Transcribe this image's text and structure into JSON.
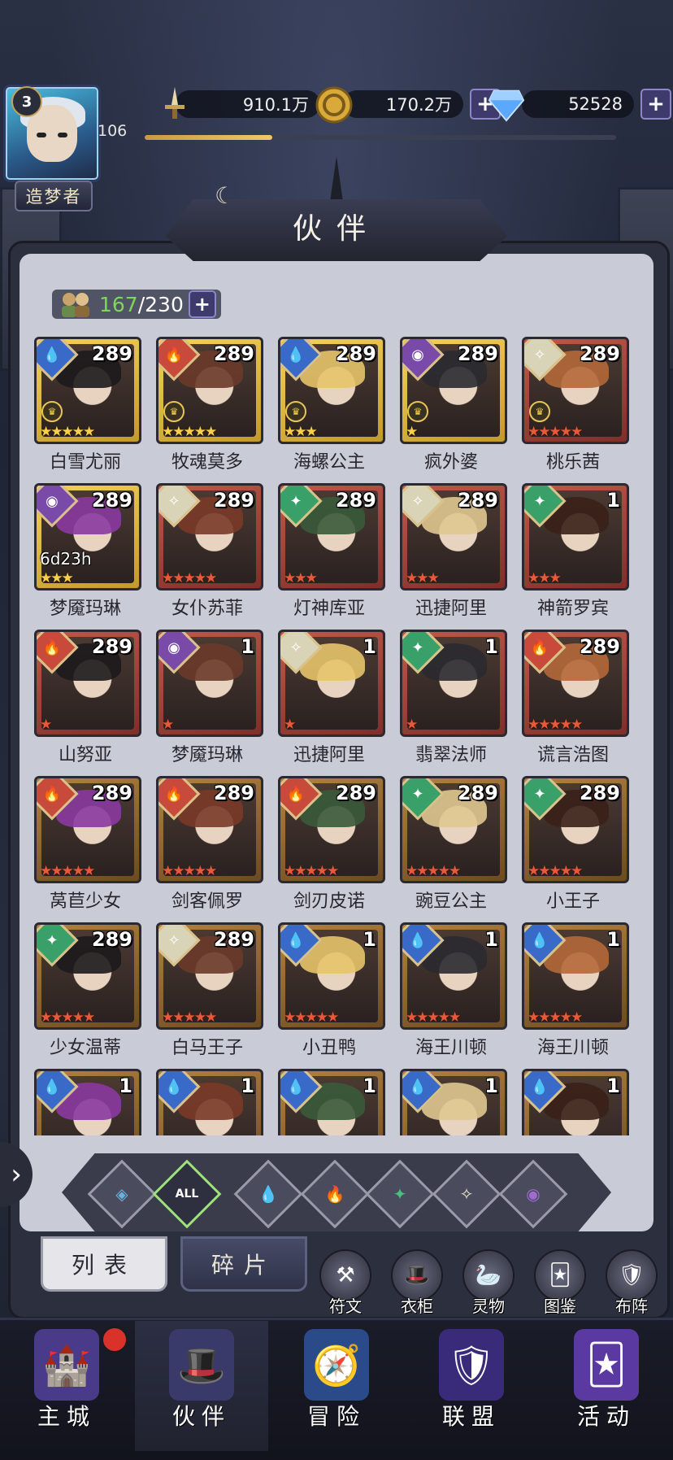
{
  "player": {
    "vip_level": "3",
    "level": "106",
    "title": "造梦者"
  },
  "resources": {
    "power": "910.1万",
    "gold": "170.2万",
    "diamonds": "52528"
  },
  "exp_progress": 0.27,
  "panel": {
    "title": "伙伴",
    "owned": "167",
    "capacity": "/230"
  },
  "heroes": [
    {
      "name": "白雪尤丽",
      "level": "289",
      "frame": "gold",
      "element": "water",
      "stars": "★★★★★",
      "star_color": "y",
      "crown": true
    },
    {
      "name": "牧魂莫多",
      "level": "289",
      "frame": "gold",
      "element": "fire",
      "stars": "★★★★★",
      "star_color": "y",
      "crown": true
    },
    {
      "name": "海螺公主",
      "level": "289",
      "frame": "gold",
      "element": "water",
      "stars": "★★★",
      "star_color": "y",
      "crown": true
    },
    {
      "name": "疯外婆",
      "level": "289",
      "frame": "gold",
      "element": "dark",
      "stars": "★",
      "star_color": "y",
      "crown": true
    },
    {
      "name": "桃乐茜",
      "level": "289",
      "frame": "red",
      "element": "light",
      "stars": "★★★★★",
      "star_color": "r",
      "crown": true
    },
    {
      "name": "梦魇玛琳",
      "level": "289",
      "frame": "gold",
      "element": "dark",
      "stars": "★★★",
      "star_color": "y",
      "timer": "6d23h"
    },
    {
      "name": "女仆苏菲",
      "level": "289",
      "frame": "red",
      "element": "light",
      "stars": "★★★★★",
      "star_color": "r"
    },
    {
      "name": "灯神库亚",
      "level": "289",
      "frame": "red",
      "element": "wind",
      "stars": "★★★",
      "star_color": "r"
    },
    {
      "name": "迅捷阿里",
      "level": "289",
      "frame": "red",
      "element": "light",
      "stars": "★★★",
      "star_color": "r"
    },
    {
      "name": "神箭罗宾",
      "level": "1",
      "frame": "red",
      "element": "wind",
      "stars": "★★★",
      "star_color": "r"
    },
    {
      "name": "山努亚",
      "level": "289",
      "frame": "red",
      "element": "fire",
      "stars": "★",
      "star_color": "r"
    },
    {
      "name": "梦魇玛琳",
      "level": "1",
      "frame": "red",
      "element": "dark",
      "stars": "★",
      "star_color": "r"
    },
    {
      "name": "迅捷阿里",
      "level": "1",
      "frame": "red",
      "element": "light",
      "stars": "★",
      "star_color": "r"
    },
    {
      "name": "翡翠法师",
      "level": "1",
      "frame": "red",
      "element": "wind",
      "stars": "★",
      "star_color": "r"
    },
    {
      "name": "谎言浩图",
      "level": "289",
      "frame": "red",
      "element": "fire",
      "stars": "★★★★★",
      "star_color": "r"
    },
    {
      "name": "莴苣少女",
      "level": "289",
      "frame": "brown",
      "element": "fire",
      "stars": "★★★★★",
      "star_color": "r"
    },
    {
      "name": "剑客佩罗",
      "level": "289",
      "frame": "brown",
      "element": "fire",
      "stars": "★★★★★",
      "star_color": "r"
    },
    {
      "name": "剑刃皮诺",
      "level": "289",
      "frame": "brown",
      "element": "fire",
      "stars": "★★★★★",
      "star_color": "r"
    },
    {
      "name": "豌豆公主",
      "level": "289",
      "frame": "brown",
      "element": "wind",
      "stars": "★★★★★",
      "star_color": "r"
    },
    {
      "name": "小王子",
      "level": "289",
      "frame": "brown",
      "element": "wind",
      "stars": "★★★★★",
      "star_color": "r"
    },
    {
      "name": "少女温蒂",
      "level": "289",
      "frame": "brown",
      "element": "wind",
      "stars": "★★★★★",
      "star_color": "r"
    },
    {
      "name": "白马王子",
      "level": "289",
      "frame": "brown",
      "element": "light",
      "stars": "★★★★★",
      "star_color": "r"
    },
    {
      "name": "小丑鸭",
      "level": "1",
      "frame": "brown",
      "element": "water",
      "stars": "★★★★★",
      "star_color": "r"
    },
    {
      "name": "海王川顿",
      "level": "1",
      "frame": "brown",
      "element": "water",
      "stars": "★★★★★",
      "star_color": "r"
    },
    {
      "name": "海王川顿",
      "level": "1",
      "frame": "brown",
      "element": "water",
      "stars": "★★★★★",
      "star_color": "r"
    },
    {
      "name": "",
      "level": "1",
      "frame": "brown",
      "element": "water",
      "stars": "",
      "star_color": "r"
    },
    {
      "name": "",
      "level": "1",
      "frame": "brown",
      "element": "water",
      "stars": "",
      "star_color": "r"
    },
    {
      "name": "",
      "level": "1",
      "frame": "brown",
      "element": "water",
      "stars": "",
      "star_color": "r"
    },
    {
      "name": "",
      "level": "1",
      "frame": "brown",
      "element": "water",
      "stars": "",
      "star_color": "r"
    },
    {
      "name": "",
      "level": "1",
      "frame": "brown",
      "element": "water",
      "stars": "",
      "star_color": "r"
    }
  ],
  "filters": [
    {
      "icon": "faction-icon",
      "label": ""
    },
    {
      "icon": "all-icon",
      "label": "ALL"
    },
    {
      "icon": "water-drop-icon",
      "label": ""
    },
    {
      "icon": "fire-icon",
      "label": ""
    },
    {
      "icon": "wind-icon",
      "label": ""
    },
    {
      "icon": "light-star-icon",
      "label": ""
    },
    {
      "icon": "dark-eye-icon",
      "label": ""
    }
  ],
  "tabs": {
    "list": "列表",
    "fragments": "碎片"
  },
  "tools": [
    "符文",
    "衣柜",
    "灵物",
    "图鉴",
    "布阵"
  ],
  "nav": [
    "主城",
    "伙伴",
    "冒险",
    "联盟",
    "活动"
  ]
}
